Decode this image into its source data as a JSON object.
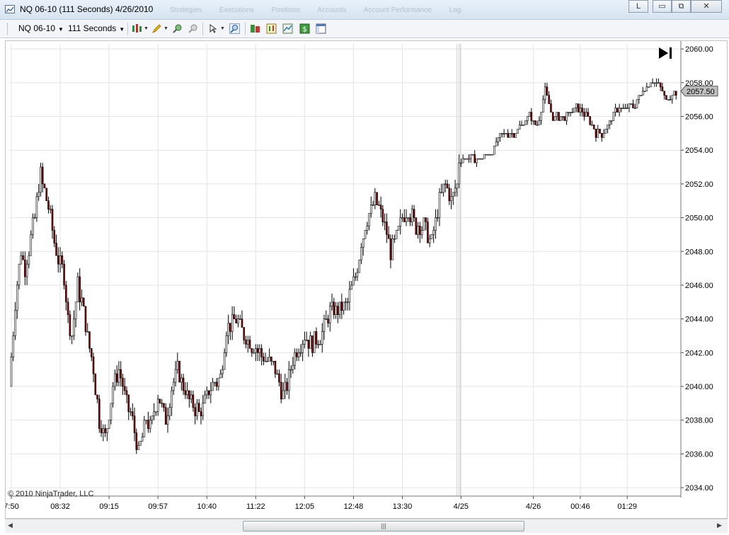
{
  "window": {
    "title": "NQ 06-10 (111 Seconds)  4/26/2010",
    "tabs": [
      "Strategies",
      "Executions",
      "Positions",
      "Accounts",
      "Account Performance",
      "Log"
    ],
    "buttons": {
      "link": "L",
      "minimize": "▭",
      "maximize": "⧉",
      "close": "✕"
    }
  },
  "toolbar": {
    "instrument": "NQ 06-10",
    "interval": "111 Seconds",
    "dropdown_glyph": "▼",
    "icons": [
      "bar-type-icon",
      "drawing-pencil-icon",
      "zoom-in-icon",
      "zoom-out-icon",
      "crosshair-pointer-icon",
      "magnifier-icon",
      "chart-trader-icon",
      "indicators-icon",
      "strategies-icon",
      "dollar-icon",
      "properties-icon"
    ]
  },
  "chart": {
    "copyright": "© 2010 NinjaTrader, LLC",
    "last_price": "2057.50",
    "go_to_end_glyph": "▶|",
    "colors": {
      "up": "#ffffff",
      "down": "#8b0000",
      "wick": "#000000",
      "grid": "#e4e4e4",
      "price_marker": "#c0c0c0"
    },
    "y_tick_labels": [
      "2060.00",
      "2058.00",
      "2056.00",
      "2054.00",
      "2052.00",
      "2050.00",
      "2048.00",
      "2046.00",
      "2044.00",
      "2042.00",
      "2040.00",
      "2038.00",
      "2036.00",
      "2034.00"
    ],
    "x_tick_labels": [
      "7:50",
      "08:32",
      "09:15",
      "09:57",
      "10:40",
      "11:22",
      "12:05",
      "12:48",
      "13:30",
      "4/25",
      "4/26",
      "00:46",
      "01:29"
    ]
  },
  "chart_data": {
    "type": "candlestick",
    "ylim": [
      2033.5,
      2060.3
    ],
    "y_ticks": [
      2060,
      2058,
      2056,
      2054,
      2052,
      2050,
      2048,
      2046,
      2044,
      2042,
      2040,
      2038,
      2036,
      2034
    ],
    "x_ticks": [
      0,
      25,
      50,
      75,
      100,
      125,
      150,
      175,
      200,
      230,
      267,
      291,
      315
    ],
    "session_break_index": 229,
    "bars_count": 341,
    "anchors": [
      [
        0,
        2040
      ],
      [
        3,
        2045
      ],
      [
        6,
        2048
      ],
      [
        8,
        2047
      ],
      [
        13,
        2050
      ],
      [
        15,
        2052
      ],
      [
        16,
        2052.5
      ],
      [
        20,
        2050.5
      ],
      [
        24,
        2048
      ],
      [
        28,
        2046.5
      ],
      [
        30,
        2044
      ],
      [
        32,
        2043
      ],
      [
        35,
        2046
      ],
      [
        37,
        2045
      ],
      [
        40,
        2043
      ],
      [
        43,
        2041
      ],
      [
        46,
        2038
      ],
      [
        49,
        2037
      ],
      [
        53,
        2040
      ],
      [
        56,
        2041
      ],
      [
        60,
        2039
      ],
      [
        63,
        2038
      ],
      [
        66,
        2036
      ],
      [
        70,
        2038
      ],
      [
        72,
        2037.5
      ],
      [
        76,
        2039.5
      ],
      [
        80,
        2038
      ],
      [
        83,
        2040
      ],
      [
        86,
        2041
      ],
      [
        89,
        2040
      ],
      [
        93,
        2039
      ],
      [
        97,
        2038.5
      ],
      [
        100,
        2039
      ],
      [
        103,
        2040
      ],
      [
        108,
        2040.5
      ],
      [
        111,
        2043.5
      ],
      [
        116,
        2044
      ],
      [
        120,
        2043
      ],
      [
        124,
        2042.5
      ],
      [
        128,
        2042
      ],
      [
        132,
        2041.5
      ],
      [
        136,
        2041
      ],
      [
        140,
        2039.5
      ],
      [
        143,
        2040.5
      ],
      [
        146,
        2042
      ],
      [
        151,
        2043
      ],
      [
        155,
        2042.5
      ],
      [
        159,
        2043
      ],
      [
        164,
        2044.5
      ],
      [
        169,
        2044.5
      ],
      [
        173,
        2045
      ],
      [
        177,
        2046.5
      ],
      [
        180,
        2048.5
      ],
      [
        183,
        2050
      ],
      [
        187,
        2051
      ],
      [
        191,
        2050
      ],
      [
        195,
        2048
      ],
      [
        197,
        2048.5
      ],
      [
        201,
        2050
      ],
      [
        204,
        2050.5
      ],
      [
        208,
        2049.5
      ],
      [
        212,
        2049.5
      ],
      [
        216,
        2048.5
      ],
      [
        220,
        2051
      ],
      [
        223,
        2052
      ],
      [
        226,
        2051
      ],
      [
        229,
        2052
      ],
      [
        230,
        2053.5
      ],
      [
        240,
        2053.5
      ],
      [
        246,
        2053.8
      ],
      [
        252,
        2055
      ],
      [
        258,
        2055
      ],
      [
        262,
        2055.5
      ],
      [
        266,
        2056
      ],
      [
        270,
        2055.5
      ],
      [
        274,
        2057.5
      ],
      [
        278,
        2056
      ],
      [
        284,
        2056
      ],
      [
        290,
        2056.5
      ],
      [
        296,
        2056
      ],
      [
        300,
        2055
      ],
      [
        304,
        2055
      ],
      [
        308,
        2056
      ],
      [
        312,
        2056.5
      ],
      [
        316,
        2056.5
      ],
      [
        320,
        2056.7
      ],
      [
        324,
        2057.5
      ],
      [
        328,
        2058
      ],
      [
        332,
        2058
      ],
      [
        336,
        2057
      ],
      [
        340,
        2057.5
      ]
    ]
  }
}
